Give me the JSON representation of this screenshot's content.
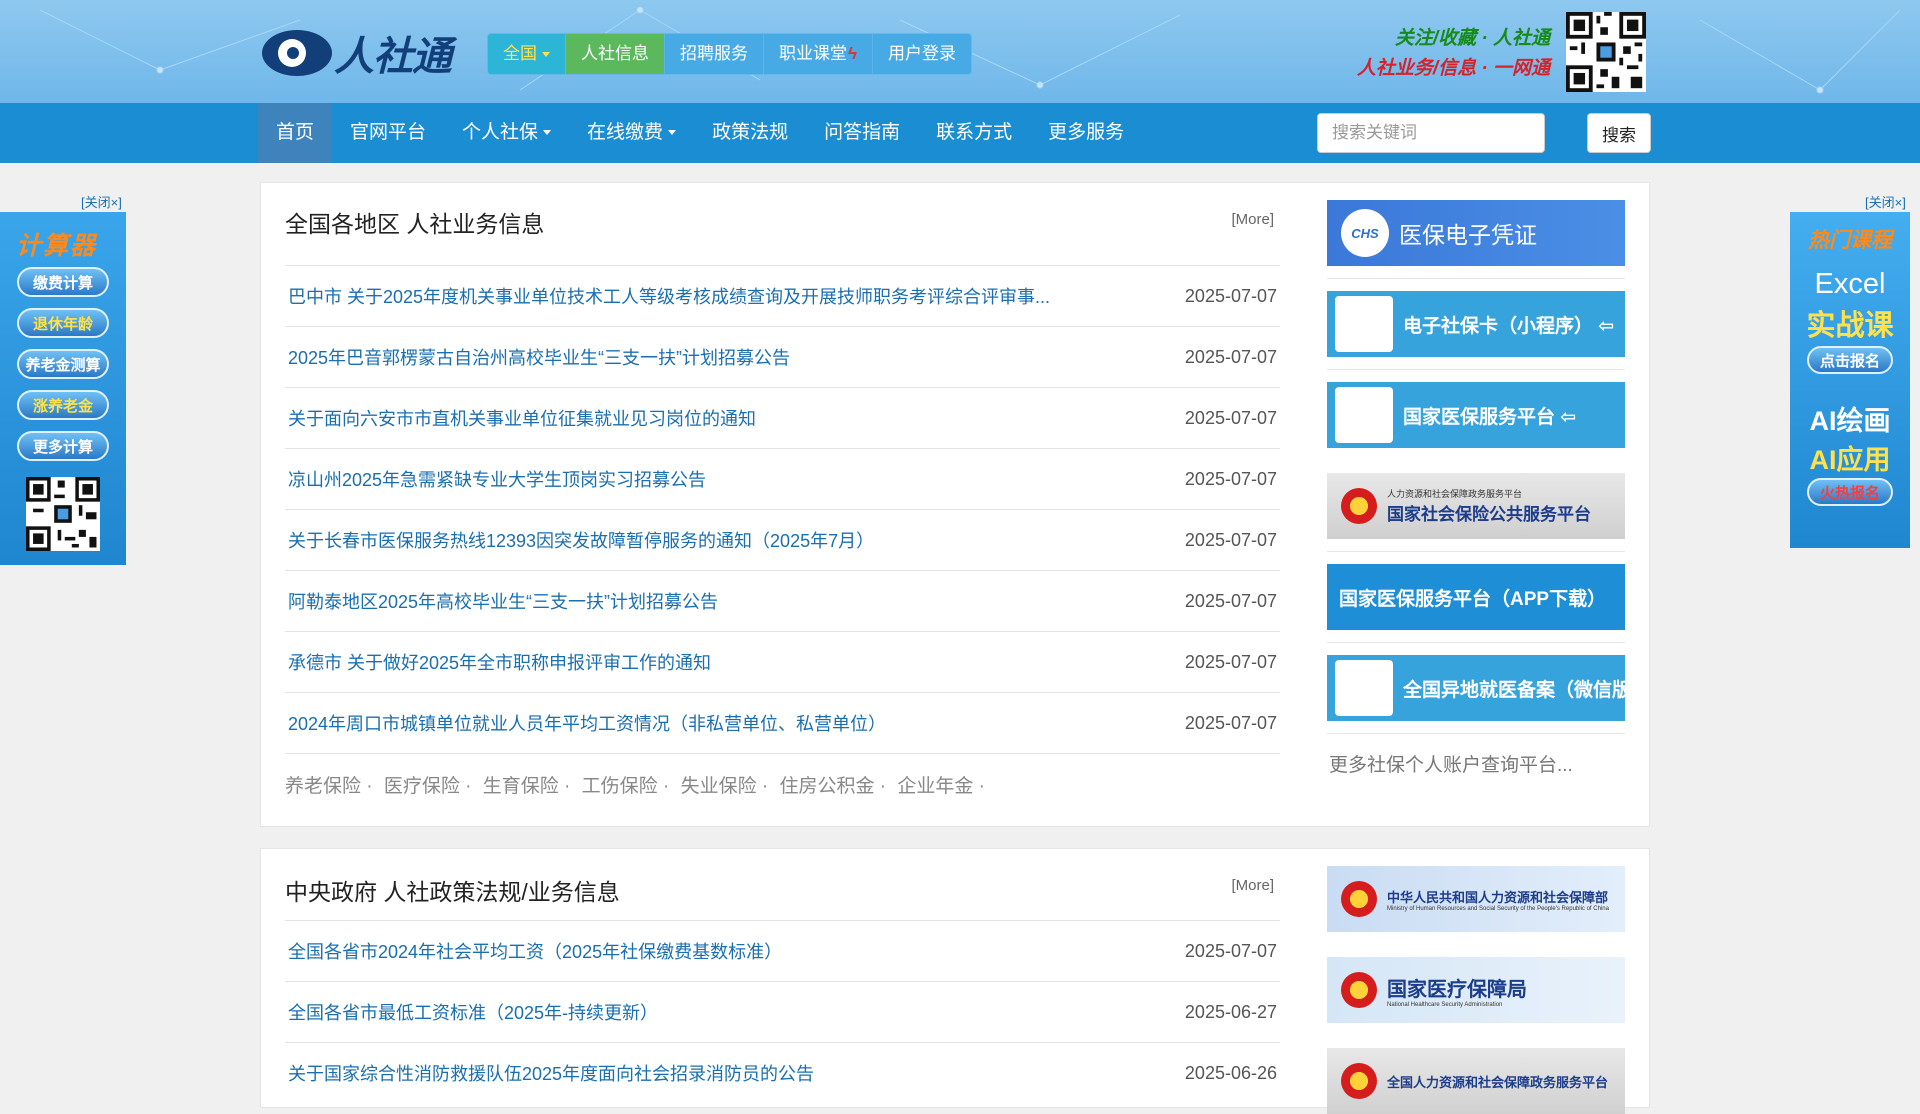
{
  "site": {
    "logo_text": "人社通",
    "slogan_line1": "关注/收藏 · 人社通",
    "slogan_line2": "人社业务/信息 · 一网通"
  },
  "top_nav": [
    {
      "label": "全国",
      "dropdown": true
    },
    {
      "label": "人社信息",
      "active": true
    },
    {
      "label": "招聘服务"
    },
    {
      "label": "职业课堂"
    },
    {
      "label": "用户登录"
    }
  ],
  "main_nav": [
    {
      "label": "首页",
      "active": true
    },
    {
      "label": "官网平台"
    },
    {
      "label": "个人社保",
      "dropdown": true
    },
    {
      "label": "在线缴费",
      "dropdown": true
    },
    {
      "label": "政策法规"
    },
    {
      "label": "问答指南"
    },
    {
      "label": "联系方式"
    },
    {
      "label": "更多服务"
    }
  ],
  "search": {
    "placeholder": "搜索关键词",
    "button": "搜索"
  },
  "left_ad": {
    "close": "[关闭×]",
    "title": "计算器",
    "buttons": [
      "缴费计算",
      "退休年龄",
      "养老金测算",
      "涨养老金",
      "更多计算"
    ]
  },
  "right_ad": {
    "close": "[关闭×]",
    "title": "热门课程",
    "line1": "Excel",
    "line2": "实战课",
    "btn1": "点击报名",
    "line3": "AI绘画",
    "line4": "AI应用",
    "btn2": "火热报名"
  },
  "section1": {
    "title": "全国各地区 人社业务信息",
    "more": "[More]",
    "items": [
      {
        "title": "巴中市 关于2025年度机关事业单位技术工人等级考核成绩查询及开展技师职务考评综合评审事...",
        "date": "2025-07-07"
      },
      {
        "title": "2025年巴音郭楞蒙古自治州高校毕业生“三支一扶”计划招募公告",
        "date": "2025-07-07"
      },
      {
        "title": "关于面向六安市市直机关事业单位征集就业见习岗位的通知",
        "date": "2025-07-07"
      },
      {
        "title": "凉山州2025年急需紧缺专业大学生顶岗实习招募公告",
        "date": "2025-07-07"
      },
      {
        "title": "关于长春市医保服务热线12393因突发故障暂停服务的通知（2025年7月）",
        "date": "2025-07-07"
      },
      {
        "title": "阿勒泰地区2025年高校毕业生“三支一扶”计划招募公告",
        "date": "2025-07-07"
      },
      {
        "title": "承德市 关于做好2025年全市职称申报评审工作的通知",
        "date": "2025-07-07"
      },
      {
        "title": "2024年周口市城镇单位就业人员年平均工资情况（非私营单位、私营单位）",
        "date": "2025-07-07"
      }
    ],
    "tags": [
      "养老保险 ·",
      "医疗保险 ·",
      "生育保险 ·",
      "工伤保险 ·",
      "失业保险 ·",
      "住房公积金 ·",
      "企业年金 ·"
    ],
    "cards": [
      {
        "label": "医保电子凭证",
        "icon_text": "CHS"
      },
      {
        "label": "电子社保卡（小程序） ⇦"
      },
      {
        "label": "国家医保服务平台 ⇦"
      },
      {
        "label": "国家社会保险公共服务平台",
        "small": "人力资源和社会保障政务服务平台"
      },
      {
        "label": "国家医保服务平台（APP下载）"
      },
      {
        "label": "全国异地就医备案（微信版）"
      }
    ],
    "more_platforms": "更多社保个人账户查询平台..."
  },
  "section2": {
    "title": "中央政府 人社政策法规/业务信息",
    "more": "[More]",
    "items": [
      {
        "title": "全国各省市2024年社会平均工资（2025年社保缴费基数标准）",
        "date": "2025-07-07"
      },
      {
        "title": "全国各省市最低工资标准（2025年-持续更新）",
        "date": "2025-06-27"
      },
      {
        "title": "关于国家综合性消防救援队伍2025年度面向社会招录消防员的公告",
        "date": "2025-06-26"
      }
    ],
    "cards": [
      {
        "label": "中华人民共和国人力资源和社会保障部",
        "en": "Ministry of Human Resources and Social Security of the People's Republic of China"
      },
      {
        "label": "国家医疗保障局",
        "en": "National Healthcare Security Administration"
      },
      {
        "label": "全国人力资源和社会保障政务服务平台"
      }
    ]
  },
  "colors": {
    "nav_blue": "#1a8dd3",
    "header_blue": "#8ec8ef",
    "link_blue": "#1a6fb0",
    "active_green": "#5cb85c"
  }
}
